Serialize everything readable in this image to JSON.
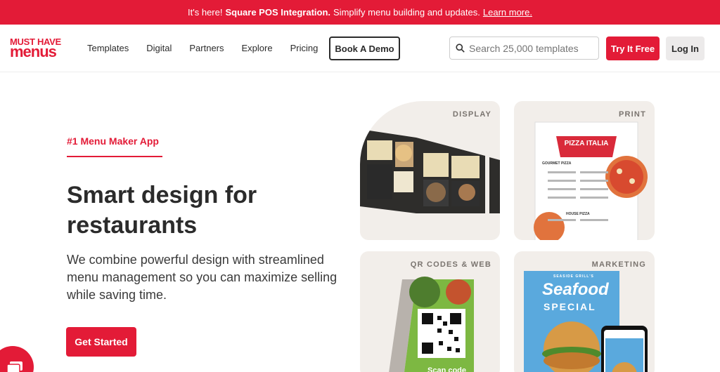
{
  "banner": {
    "prefix": "It's here!",
    "highlight": "Square POS Integration.",
    "text": "Simplify menu building and updates.",
    "link": "Learn more."
  },
  "logo": {
    "line1": "MUST HAVE",
    "line2": "menus"
  },
  "nav": {
    "items": [
      {
        "label": "Templates"
      },
      {
        "label": "Digital"
      },
      {
        "label": "Partners"
      },
      {
        "label": "Explore"
      },
      {
        "label": "Pricing"
      }
    ],
    "demo_label": "Book A Demo",
    "search_placeholder": "Search 25,000 templates",
    "try_label": "Try It Free",
    "login_label": "Log In"
  },
  "hero": {
    "eyebrow": "#1 Menu Maker App",
    "headline": "Smart design for restaurants",
    "subtext": "We combine powerful design with streamlined menu management so you can maximize selling while saving time.",
    "cta": "Get Started"
  },
  "cards": [
    {
      "label": "DISPLAY"
    },
    {
      "label": "PRINT",
      "menu_title": "PIZZA ITALIA",
      "section1": "GOURMET PIZZA",
      "section2": "HOUSE PIZZA"
    },
    {
      "label": "QR CODES & WEB",
      "caption": "Scan code"
    },
    {
      "label": "MARKETING",
      "poster_small": "SEASIDE GRILL'S",
      "poster_title": "Seafood",
      "poster_sub": "SPECIAL"
    }
  ],
  "colors": {
    "brand": "#e31b37",
    "card_bg": "#f2eeea"
  }
}
